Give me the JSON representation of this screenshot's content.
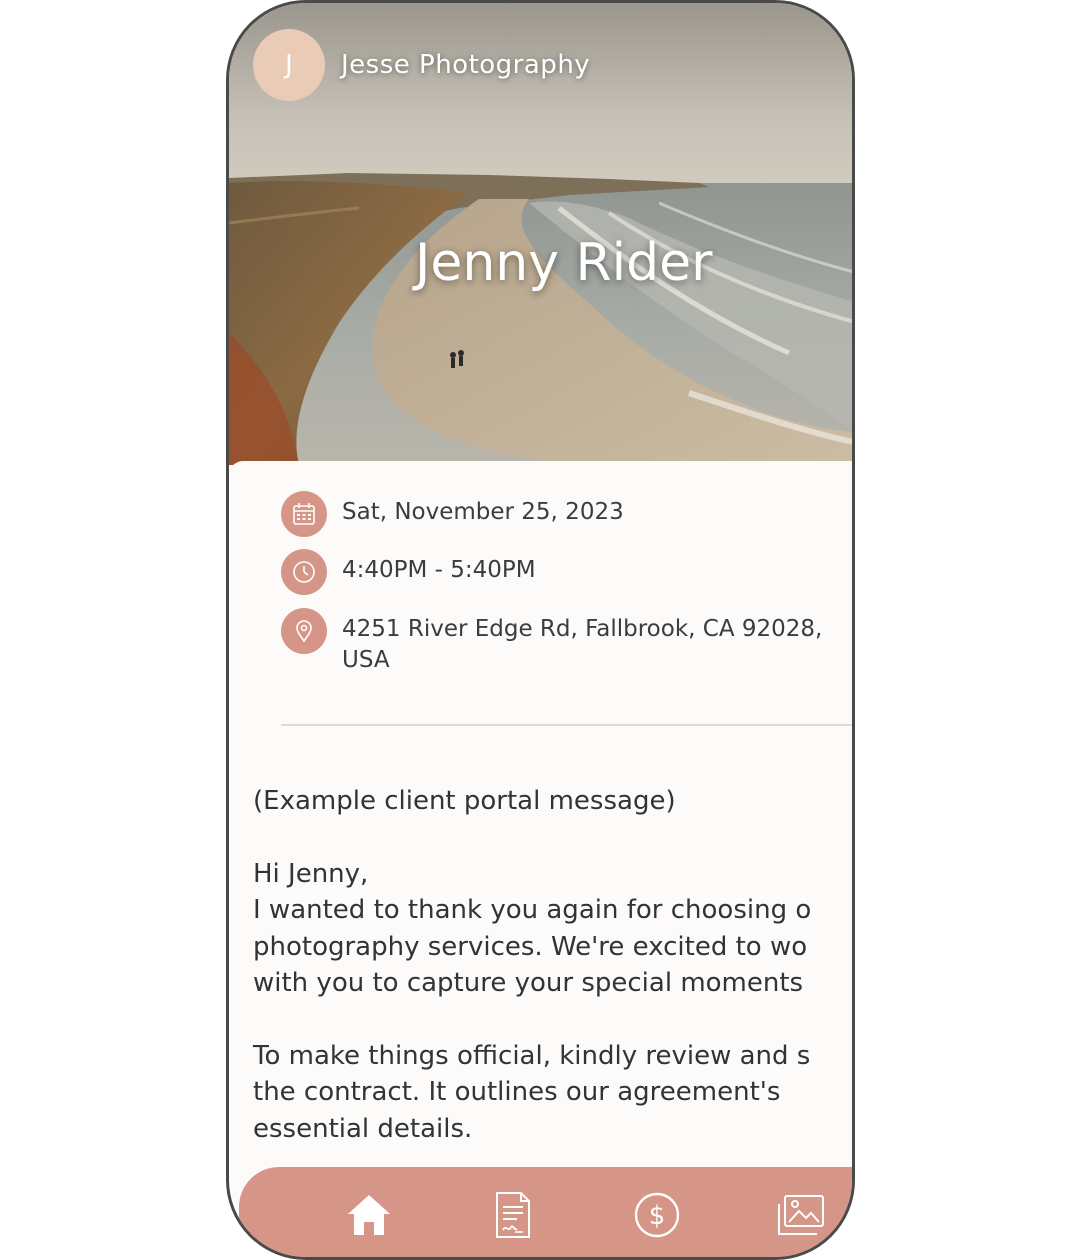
{
  "header": {
    "avatar_initial": "J",
    "brand_name": "Jesse Photography",
    "client_name": "Jenny Rider"
  },
  "details": {
    "date": "Sat, November 25, 2023",
    "time": "4:40PM - 5:40PM",
    "address": "4251 River Edge Rd, Fallbrook, CA 92028, USA"
  },
  "message": {
    "intro": "(Example client portal message)",
    "greeting": "Hi Jenny,",
    "para1_line1": "I wanted to thank you again for choosing o",
    "para1_line2": "photography services. We're excited to wo",
    "para1_line3": "with you to capture your special moments",
    "para2_line1": "To make things official, kindly review and s",
    "para2_line2": "the contract. It outlines our agreement's",
    "para2_line3": "essential details."
  },
  "nav": {
    "items": [
      "home-icon",
      "contract-icon",
      "payment-icon",
      "gallery-icon"
    ]
  },
  "colors": {
    "accent": "#d59687",
    "avatar": "#e9cbb6",
    "text": "#3c3c3c",
    "background": "#fdfbf9"
  }
}
